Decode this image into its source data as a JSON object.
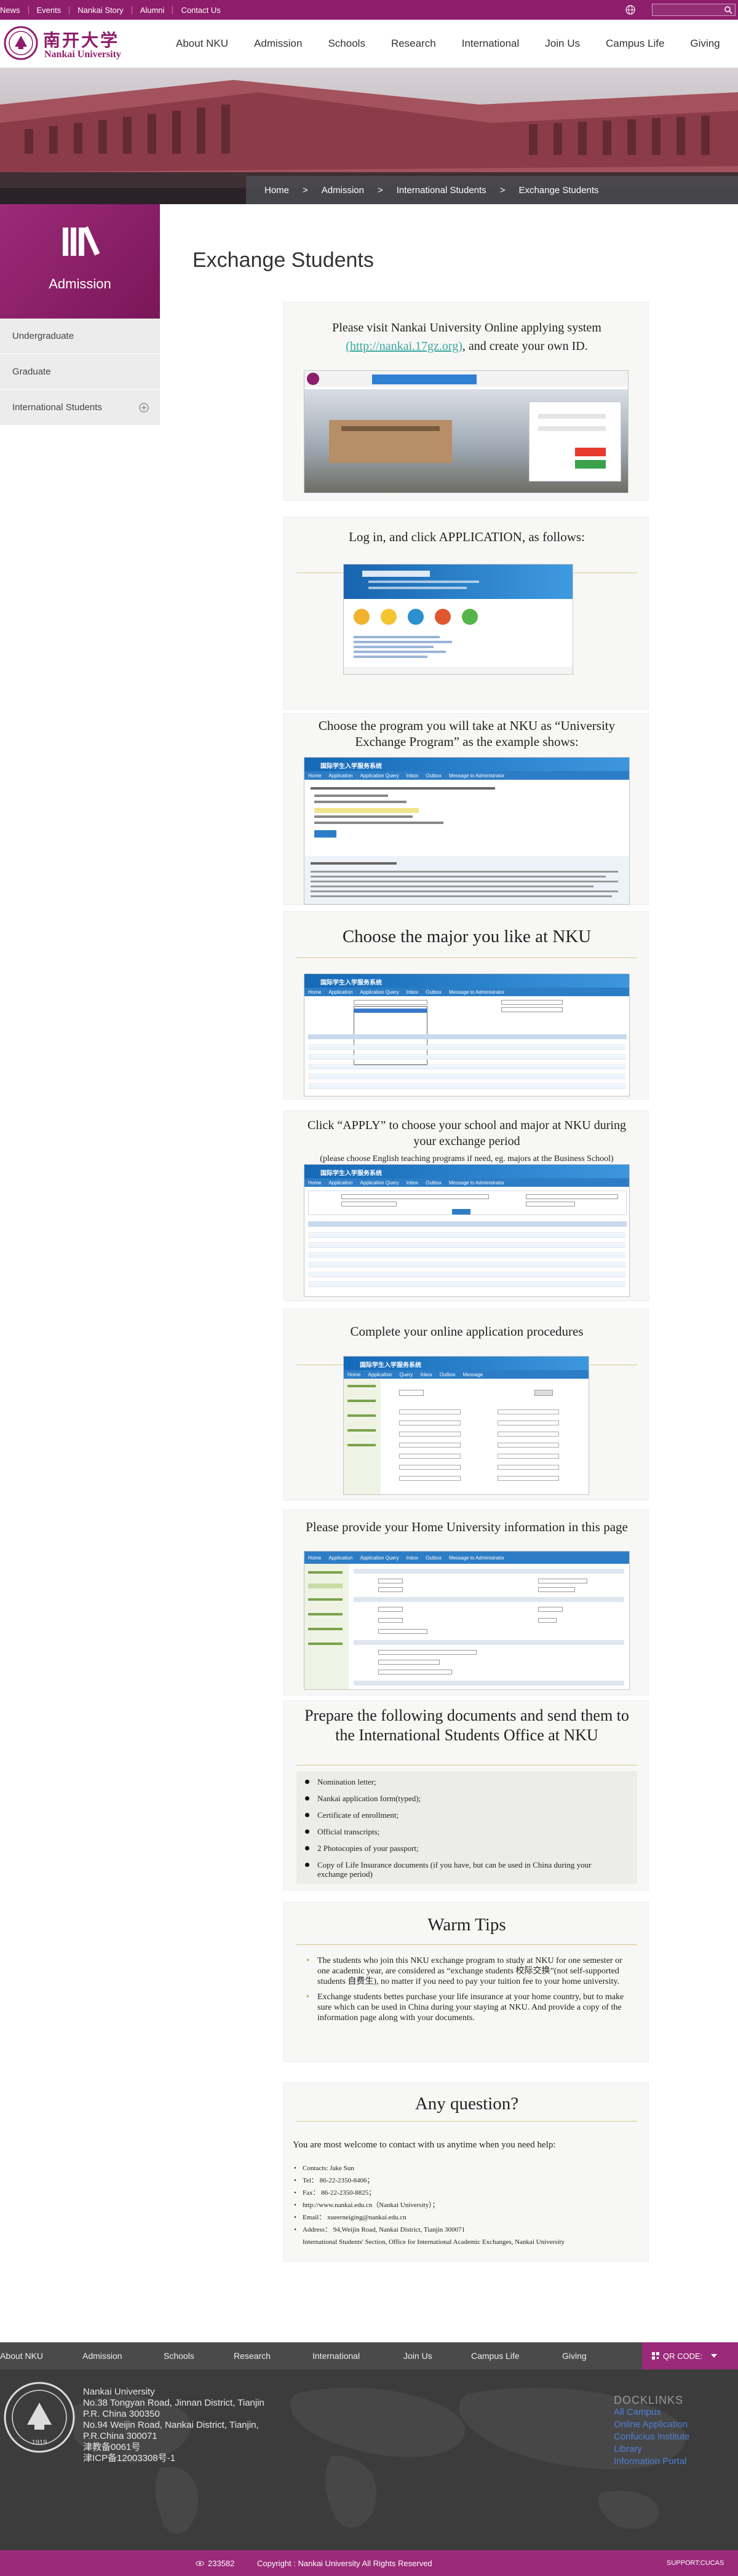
{
  "topbar": {
    "links": [
      "News",
      "Events",
      "Nankai Story",
      "Alumni",
      "Contact Us"
    ],
    "search_placeholder": ""
  },
  "logo": {
    "cn": "南开大学",
    "en": "Nankai University"
  },
  "nav": [
    "About NKU",
    "Admission",
    "Schools",
    "Research",
    "International",
    "Join Us",
    "Campus Life",
    "Giving"
  ],
  "breadcrumb": [
    "Home",
    ">",
    "Admission",
    ">",
    "International Students",
    ">",
    "Exchange Students"
  ],
  "sidebar": {
    "title": "Admission",
    "items": [
      "Undergraduate",
      "Graduate",
      "International Students"
    ]
  },
  "page_title": "Exchange Students",
  "steps": [
    {
      "line1": "Please visit Nankai University Online applying system",
      "link": "(http://nankai.17gz.org)",
      "line2": ", and create your own ID."
    },
    {
      "text": "Log in, and click APPLICATION, as follows:"
    },
    {
      "text": "Choose the program you will take at NKU as “University Exchange Program” as the example shows:"
    },
    {
      "text": "Choose the major you like at NKU"
    },
    {
      "line1": "Click “APPLY” to choose your school and major at NKU during your exchange period",
      "line2": "(please choose English teaching programs if need, eg. majors at the Business School)"
    },
    {
      "text": "Complete your online application procedures"
    },
    {
      "text": "Please provide your Home University information in this page"
    }
  ],
  "documents": {
    "title": "Prepare the following documents and send them to the International Students Office at NKU",
    "items": [
      "Nomination letter;",
      "Nankai application form(typed);",
      "Certificate of enrollment;",
      "Official transcripts;",
      "2 Photocopies of your passport;",
      "Copy of Life Insurance documents (if you have, but can be used in China during your exchange period)"
    ]
  },
  "tips": {
    "title": "Warm Tips",
    "items": [
      "The students who join this NKU exchange program to study at NKU for one semester or one academic year, are considered as “exchange students 校际交换”(not self-supported students 自费生), no matter if you need to pay your tuition fee to your home university.",
      "Exchange students bettes purchase your life insurance at your home country, but to make sure which can be used in China during your staying at NKU. And provide a copy of the information page along with your documents."
    ]
  },
  "question": {
    "title": "Any question?",
    "intro": "You are most welcome to contact with us anytime when you need help:",
    "items": [
      "Contacts: Jake Sun",
      "Tel：  86-22-2350-8406；",
      "Fax：  86-22-2350-8825；",
      "http://www.nankai.edu.cn（Nankai University）；",
      "Email：  xueerneiging@nankai.edu.cn",
      "Address：  94,Weijin Road, Nankai District, Tianjin 300071"
    ],
    "footer": "International Students' Section, Office for International Academic Exchanges, Nankai University"
  },
  "footnav": [
    "About NKU",
    "Admission",
    "Schools",
    "Research",
    "International",
    "Join Us",
    "Campus Life",
    "Giving"
  ],
  "qr_label": "QR CODE:",
  "footer_address": [
    "Nankai University",
    "No.38 Tongyan Road, Jinnan District, Tianjin",
    "P.R. China 300350",
    "No.94 Weijin Road,  Nankai District, Tianjin,",
    "P.R.China  300071",
    "津教备0061号",
    "津ICP备12003308号-1"
  ],
  "footer_links": {
    "heading": "DOCKLINKS",
    "items": [
      "All Campus",
      "Online Application",
      "Confucius Institute",
      "Library",
      "Information Portal"
    ]
  },
  "copyright": {
    "visits": "233582",
    "text": "Copyright : Nankai University All Rights Reserved",
    "support": "SUPPORT:CUCAS"
  },
  "colors": {
    "brand": "#8e1d6b",
    "accent": "#9b2a7a",
    "link": "#3aa7a0",
    "footer": "#3c3c3c"
  }
}
